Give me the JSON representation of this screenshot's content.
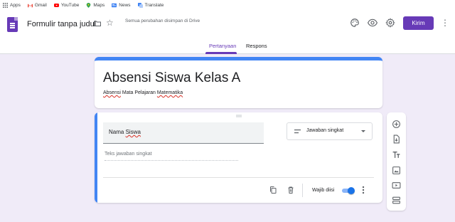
{
  "bookmarks": [
    {
      "label": "Apps",
      "icon": "apps-grid-icon"
    },
    {
      "label": "Gmail",
      "icon": "gmail-icon"
    },
    {
      "label": "YouTube",
      "icon": "youtube-icon"
    },
    {
      "label": "Maps",
      "icon": "maps-icon"
    },
    {
      "label": "News",
      "icon": "news-icon"
    },
    {
      "label": "Translate",
      "icon": "translate-icon"
    }
  ],
  "header": {
    "doc_title": "Formulir tanpa judul",
    "save_status": "Semua perubahan disimpan di Drive",
    "send_label": "Kirim",
    "icons": [
      "palette-icon",
      "preview-eye-icon",
      "settings-gear-icon",
      "more-vert-icon"
    ]
  },
  "tabs": [
    {
      "label": "Pertanyaan",
      "active": true
    },
    {
      "label": "Respons",
      "active": false
    }
  ],
  "form": {
    "title": "Absensi Siswa Kelas A",
    "description_parts": [
      "Absensi",
      "Mata Pelajaran",
      "Matematika"
    ]
  },
  "question": {
    "title_parts": [
      "Nama",
      "Siswa"
    ],
    "type_label": "Jawaban singkat",
    "answer_placeholder": "Teks jawaban singkat",
    "required_label": "Wajib diisi",
    "required": true
  },
  "toolbar": [
    "add-question-icon",
    "import-questions-icon",
    "add-title-icon",
    "add-image-icon",
    "add-video-icon",
    "add-section-icon"
  ],
  "colors": {
    "accent": "#673ab7",
    "page_background": "#f0ebf8",
    "active_card": "#4285f4",
    "toggle_on": "#1a73e8"
  }
}
